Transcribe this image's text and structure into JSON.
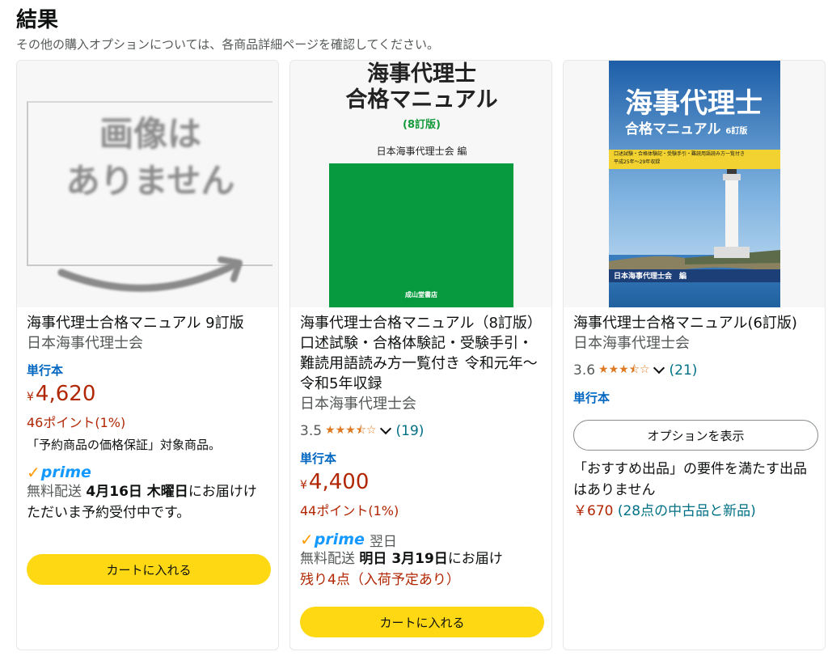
{
  "header": {
    "title": "結果",
    "subtitle": "その他の購入オプションについては、各商品詳細ページを確認してください。"
  },
  "products": [
    {
      "placeholder_text": "画像は\nありません",
      "title": "海事代理士合格マニュアル 9訂版",
      "author": "日本海事代理士会",
      "format": "単行本",
      "price_symbol": "¥",
      "price": "4,620",
      "points": "46ポイント(1%)",
      "guarantee_note": "「予約商品の価格保証」対象商品。",
      "prime_check": "✓",
      "prime": "prime",
      "delivery_prefix": "無料配送 ",
      "delivery_date": "4月16日 木曜日",
      "delivery_suffix": "にお届けけ",
      "preorder_note": "ただいま予約受付中です。",
      "cart_button": "カートに入れる"
    },
    {
      "cover_title_1": "海事代理士",
      "cover_title_2": "合格マニュアル",
      "cover_edition": "(8訂版)",
      "cover_publisher": "日本海事代理士会 編",
      "cover_house": "成山堂書店",
      "title": "海事代理士合格マニュアル（8訂版）口述試験・合格体験記・受験手引・難読用語読み方一覧付き 令和元年〜令和5年収録",
      "author": "日本海事代理士会",
      "rating": "3.5",
      "stars": 3.5,
      "review_count": "(19)",
      "format": "単行本",
      "price_symbol": "¥",
      "price": "4,400",
      "points": "44ポイント(1%)",
      "prime_check": "✓",
      "prime": "prime",
      "prime_speed": "翌日",
      "delivery_prefix": "無料配送 ",
      "delivery_date": "明日 3月19日",
      "delivery_suffix": "にお届け",
      "stock": "残り4点（入荷予定あり）",
      "cart_button": "カートに入れる"
    },
    {
      "cover_title_1": "海事代理士",
      "cover_title_2": "合格マニュアル",
      "cover_edition": "6訂版",
      "cover_banner": "口述試験・合格体験記・受験手引・難読用語読み方一覧付き\n平成25年〜29年収録",
      "cover_author": "日本海事代理士会　編",
      "title": "海事代理士合格マニュアル(6訂版)",
      "author": "日本海事代理士会",
      "rating": "3.6",
      "stars": 3.6,
      "review_count": "(21)",
      "format": "単行本",
      "options_button": "オプションを表示",
      "recommended_note": "「おすすめ出品」の要件を満たす出品はありません",
      "used_price": "￥670",
      "used_offers": "(28点の中古品と新品)"
    }
  ],
  "colors": {
    "price": "#b12704",
    "link": "#007185",
    "format": "#0066c0",
    "cart_button": "#ffd814",
    "star": "#de7921",
    "prime": "#1399ff",
    "cover_green": "#079a3f",
    "cover_blue": "#2a64a8"
  }
}
